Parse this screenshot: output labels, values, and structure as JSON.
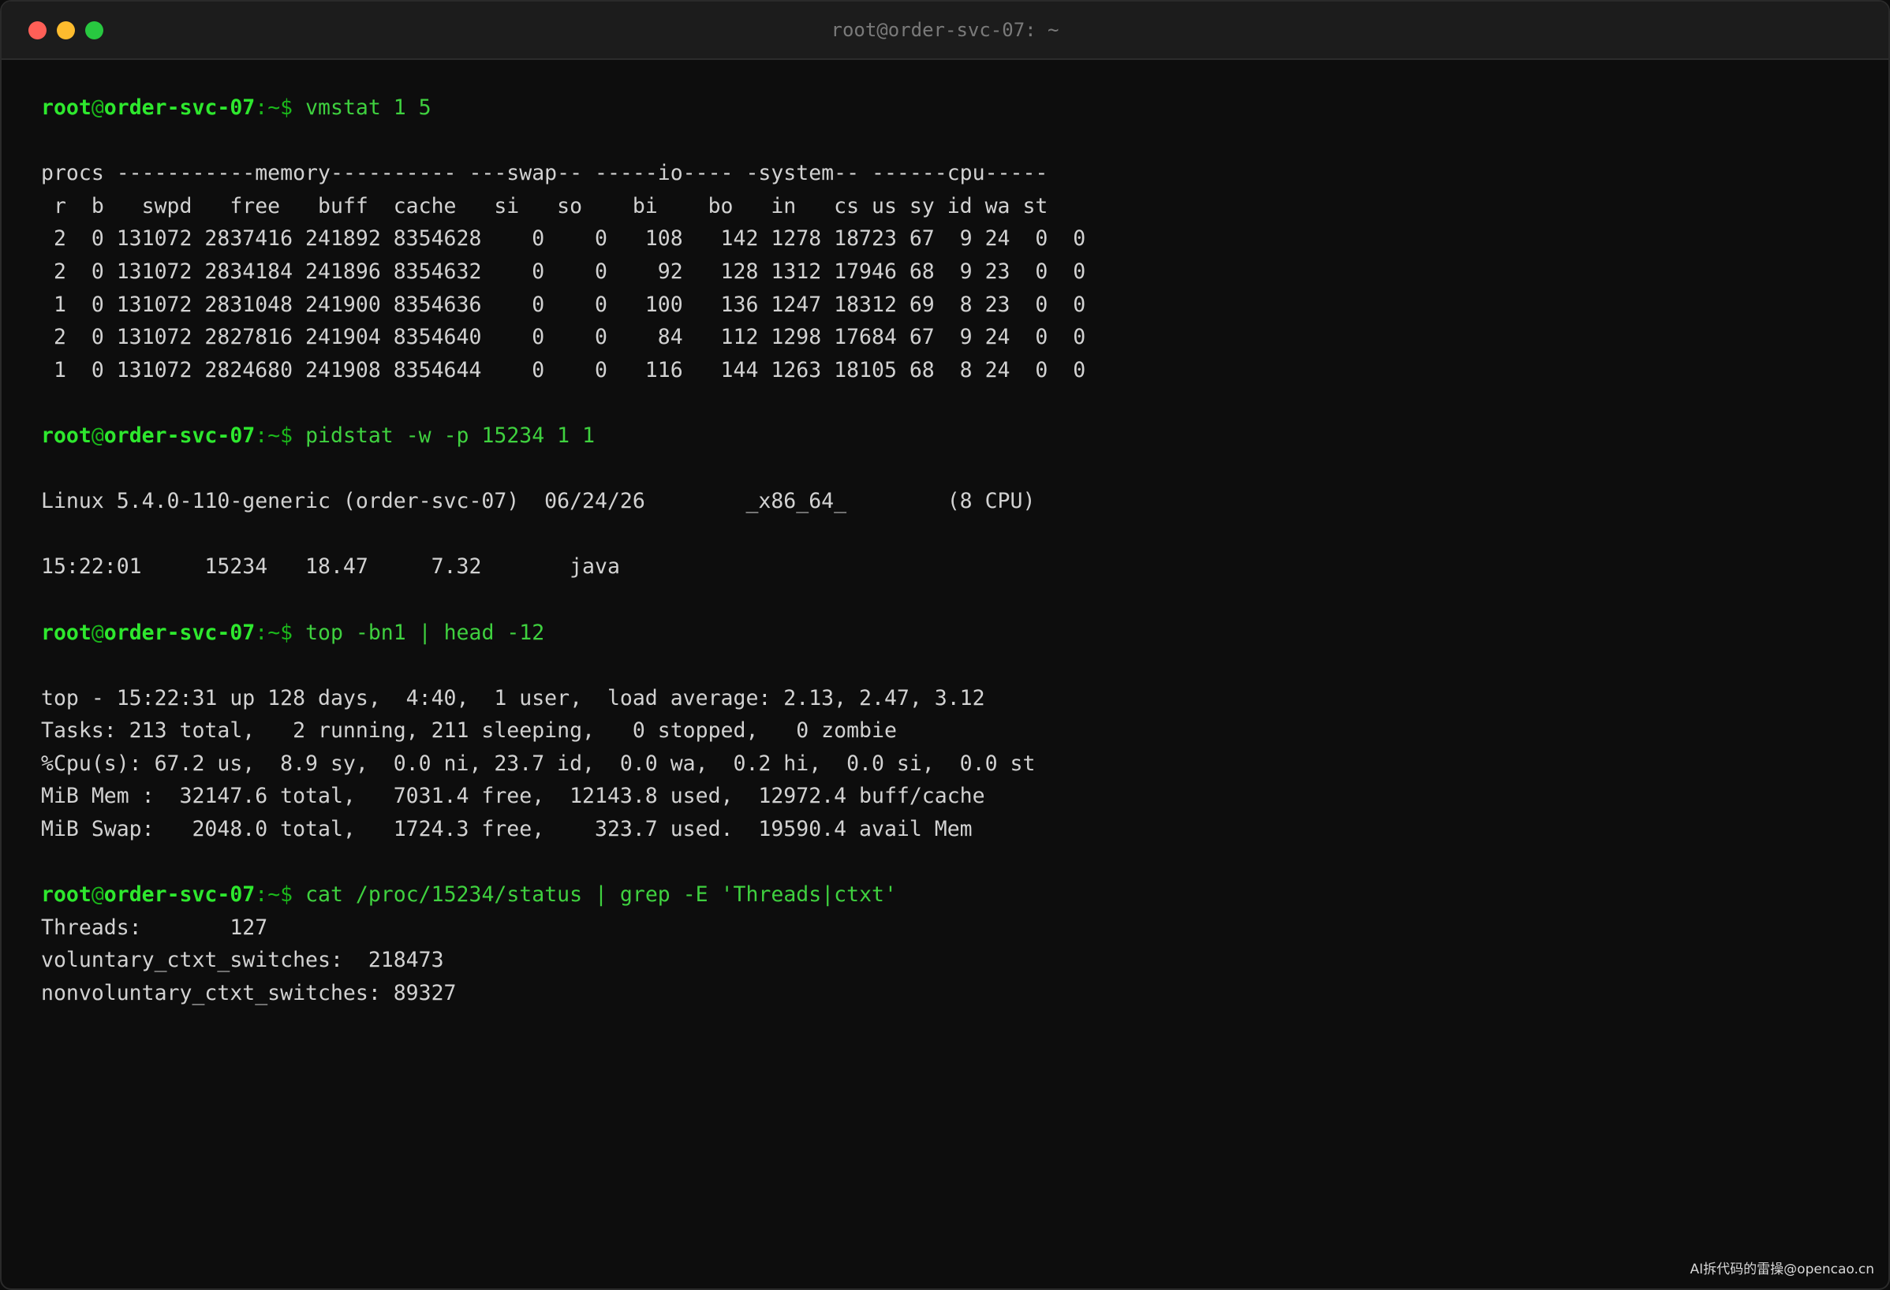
{
  "window": {
    "title": "root@order-svc-07: ~"
  },
  "prompt": {
    "user": "root",
    "at": "@",
    "host": "order-svc-07",
    "path": ":~$ "
  },
  "blocks": [
    {
      "command": "vmstat 1 5",
      "output": [
        "",
        "procs -----------memory---------- ---swap-- -----io---- -system-- ------cpu-----",
        " r  b   swpd   free   buff  cache   si   so    bi    bo   in   cs us sy id wa st",
        " 2  0 131072 2837416 241892 8354628    0    0   108   142 1278 18723 67  9 24  0  0",
        " 2  0 131072 2834184 241896 8354632    0    0    92   128 1312 17946 68  9 23  0  0",
        " 1  0 131072 2831048 241900 8354636    0    0   100   136 1247 18312 69  8 23  0  0",
        " 2  0 131072 2827816 241904 8354640    0    0    84   112 1298 17684 67  9 24  0  0",
        " 1  0 131072 2824680 241908 8354644    0    0   116   144 1263 18105 68  8 24  0  0",
        ""
      ]
    },
    {
      "command": "pidstat -w -p 15234 1 1",
      "output": [
        "",
        "Linux 5.4.0-110-generic (order-svc-07)  06/24/26        _x86_64_        (8 CPU)",
        "",
        "15:22:01     15234   18.47     7.32       java",
        ""
      ]
    },
    {
      "command": "top -bn1 | head -12",
      "output": [
        "",
        "top - 15:22:31 up 128 days,  4:40,  1 user,  load average: 2.13, 2.47, 3.12",
        "Tasks: 213 total,   2 running, 211 sleeping,   0 stopped,   0 zombie",
        "%Cpu(s): 67.2 us,  8.9 sy,  0.0 ni, 23.7 id,  0.0 wa,  0.2 hi,  0.0 si,  0.0 st",
        "MiB Mem :  32147.6 total,   7031.4 free,  12143.8 used,  12972.4 buff/cache",
        "MiB Swap:   2048.0 total,   1724.3 free,    323.7 used.  19590.4 avail Mem",
        ""
      ]
    },
    {
      "command": "cat /proc/15234/status | grep -E 'Threads|ctxt'",
      "output": [
        "Threads:       127",
        "voluntary_ctxt_switches:  218473",
        "nonvoluntary_ctxt_switches: 89327"
      ]
    }
  ],
  "watermark": "AI拆代码的雷操@opencao.cn"
}
